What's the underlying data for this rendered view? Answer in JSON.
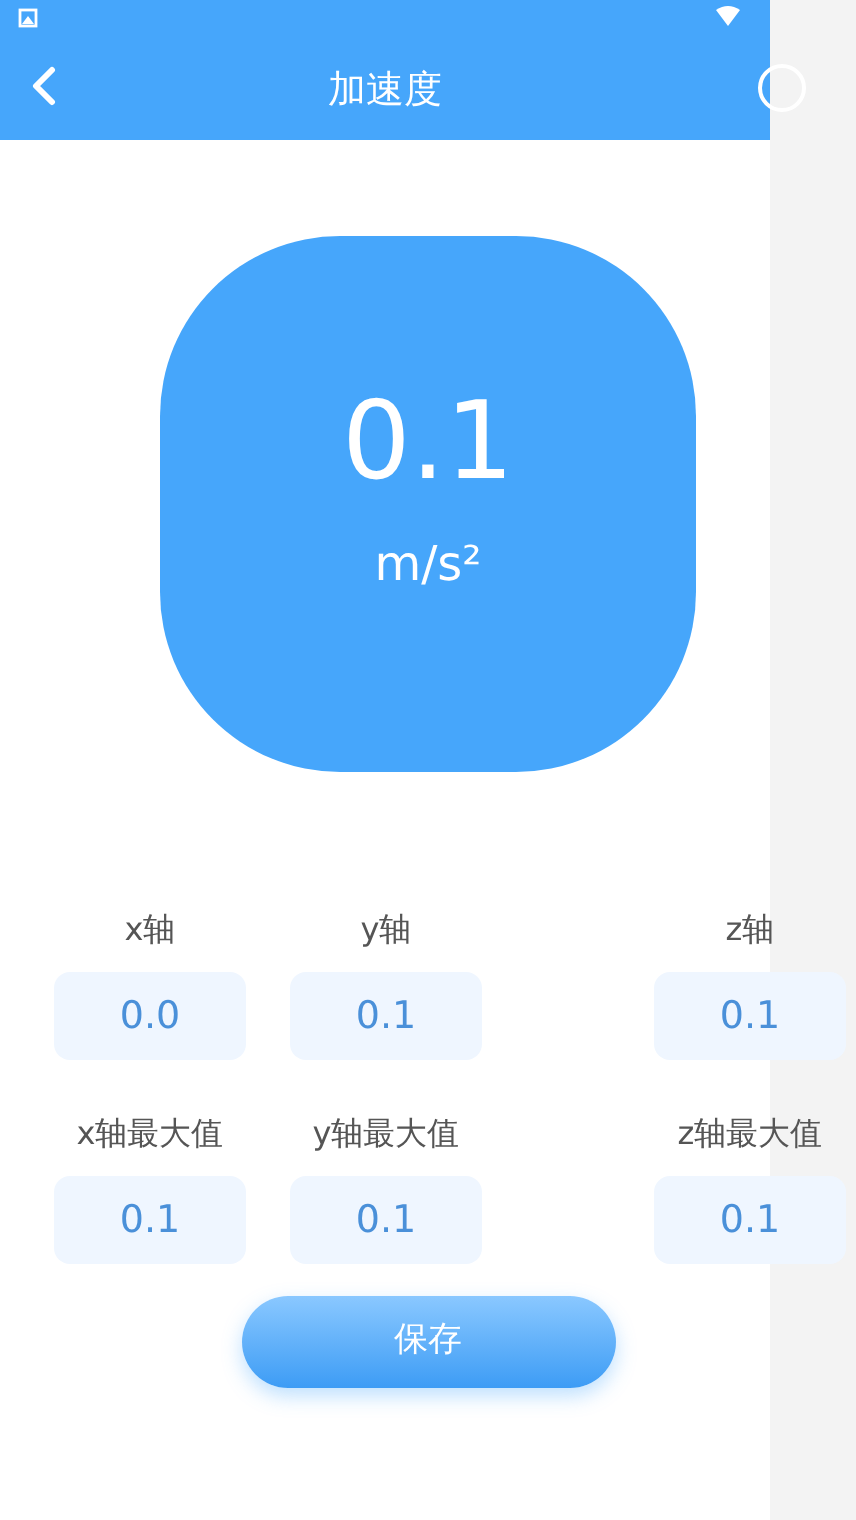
{
  "header": {
    "title": "加速度"
  },
  "reading": {
    "value": "0.1",
    "unit": "m/s²"
  },
  "fields": [
    {
      "label": "x轴",
      "value": "0.0"
    },
    {
      "label": "y轴",
      "value": "0.1"
    },
    {
      "label": "z轴",
      "value": "0.1"
    },
    {
      "label": "x轴最大值",
      "value": "0.1"
    },
    {
      "label": "y轴最大值",
      "value": "0.1"
    },
    {
      "label": "z轴最大值",
      "value": "0.1"
    }
  ],
  "save_button": "保存"
}
